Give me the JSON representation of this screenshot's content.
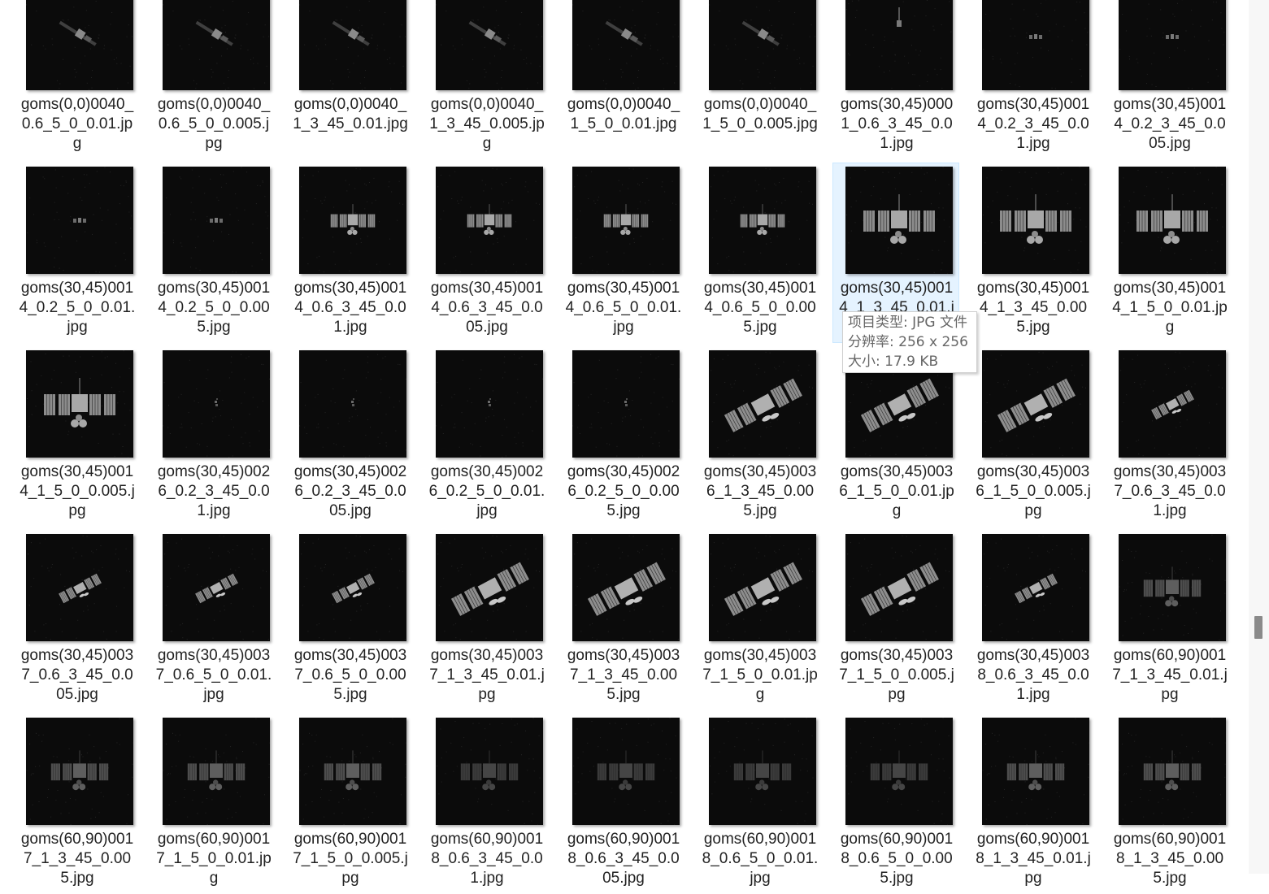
{
  "files": [
    {
      "name": "goms(0,0)0040_0.6_5_0_0.01.jpg",
      "icon": "image-thumbnail",
      "scene": "satellite-diagonal-small"
    },
    {
      "name": "goms(0,0)0040_0.6_5_0_0.005.jpg",
      "icon": "image-thumbnail",
      "scene": "satellite-diagonal-small"
    },
    {
      "name": "goms(0,0)0040_1_3_45_0.01.jpg",
      "icon": "image-thumbnail",
      "scene": "satellite-diagonal-small"
    },
    {
      "name": "goms(0,0)0040_1_3_45_0.005.jpg",
      "icon": "image-thumbnail",
      "scene": "satellite-diagonal-small"
    },
    {
      "name": "goms(0,0)0040_1_5_0_0.01.jpg",
      "icon": "image-thumbnail",
      "scene": "satellite-diagonal-small"
    },
    {
      "name": "goms(0,0)0040_1_5_0_0.005.jpg",
      "icon": "image-thumbnail",
      "scene": "satellite-diagonal-small"
    },
    {
      "name": "goms(30,45)0001_0.6_3_45_0.01.jpg",
      "icon": "image-thumbnail",
      "scene": "satellite-vertical-tiny"
    },
    {
      "name": "goms(30,45)0014_0.2_3_45_0.01.jpg",
      "icon": "image-thumbnail",
      "scene": "satellite-front-tiny"
    },
    {
      "name": "goms(30,45)0014_0.2_3_45_0.005.jpg",
      "icon": "image-thumbnail",
      "scene": "satellite-front-tiny"
    },
    {
      "name": "goms(30,45)0014_0.2_5_0_0.01.jpg",
      "icon": "image-thumbnail",
      "scene": "satellite-front-tiny"
    },
    {
      "name": "goms(30,45)0014_0.2_5_0_0.005.jpg",
      "icon": "image-thumbnail",
      "scene": "satellite-front-tiny"
    },
    {
      "name": "goms(30,45)0014_0.6_3_45_0.01.jpg",
      "icon": "image-thumbnail",
      "scene": "satellite-front-medium"
    },
    {
      "name": "goms(30,45)0014_0.6_3_45_0.005.jpg",
      "icon": "image-thumbnail",
      "scene": "satellite-front-medium"
    },
    {
      "name": "goms(30,45)0014_0.6_5_0_0.01.jpg",
      "icon": "image-thumbnail",
      "scene": "satellite-front-medium"
    },
    {
      "name": "goms(30,45)0014_0.6_5_0_0.005.jpg",
      "icon": "image-thumbnail",
      "scene": "satellite-front-medium"
    },
    {
      "name": "goms(30,45)0014_1_3_45_0.01.jpg",
      "icon": "image-thumbnail",
      "scene": "satellite-front-large",
      "selected": true
    },
    {
      "name": "goms(30,45)0014_1_3_45_0.005.jpg",
      "icon": "image-thumbnail",
      "scene": "satellite-front-large"
    },
    {
      "name": "goms(30,45)0014_1_5_0_0.01.jpg",
      "icon": "image-thumbnail",
      "scene": "satellite-front-large"
    },
    {
      "name": "goms(30,45)0014_1_5_0_0.005.jpg",
      "icon": "image-thumbnail",
      "scene": "satellite-front-large"
    },
    {
      "name": "goms(30,45)0026_0.2_3_45_0.01.jpg",
      "icon": "image-thumbnail",
      "scene": "satellite-speck"
    },
    {
      "name": "goms(30,45)0026_0.2_3_45_0.005.jpg",
      "icon": "image-thumbnail",
      "scene": "satellite-speck"
    },
    {
      "name": "goms(30,45)0026_0.2_5_0_0.01.jpg",
      "icon": "image-thumbnail",
      "scene": "satellite-speck"
    },
    {
      "name": "goms(30,45)0026_0.2_5_0_0.005.jpg",
      "icon": "image-thumbnail",
      "scene": "satellite-speck"
    },
    {
      "name": "goms(30,45)0036_1_3_45_0.005.jpg",
      "icon": "image-thumbnail",
      "scene": "satellite-angled-large"
    },
    {
      "name": "goms(30,45)0036_1_5_0_0.01.jpg",
      "icon": "image-thumbnail",
      "scene": "satellite-angled-large"
    },
    {
      "name": "goms(30,45)0036_1_5_0_0.005.jpg",
      "icon": "image-thumbnail",
      "scene": "satellite-angled-large"
    },
    {
      "name": "goms(30,45)0037_0.6_3_45_0.01.jpg",
      "icon": "image-thumbnail",
      "scene": "satellite-angled-small"
    },
    {
      "name": "goms(30,45)0037_0.6_3_45_0.005.jpg",
      "icon": "image-thumbnail",
      "scene": "satellite-angled-small"
    },
    {
      "name": "goms(30,45)0037_0.6_5_0_0.01.jpg",
      "icon": "image-thumbnail",
      "scene": "satellite-angled-small"
    },
    {
      "name": "goms(30,45)0037_0.6_5_0_0.005.jpg",
      "icon": "image-thumbnail",
      "scene": "satellite-angled-small"
    },
    {
      "name": "goms(30,45)0037_1_3_45_0.01.jpg",
      "icon": "image-thumbnail",
      "scene": "satellite-angled-large"
    },
    {
      "name": "goms(30,45)0037_1_3_45_0.005.jpg",
      "icon": "image-thumbnail",
      "scene": "satellite-angled-large"
    },
    {
      "name": "goms(30,45)0037_1_5_0_0.01.jpg",
      "icon": "image-thumbnail",
      "scene": "satellite-angled-large"
    },
    {
      "name": "goms(30,45)0037_1_5_0_0.005.jpg",
      "icon": "image-thumbnail",
      "scene": "satellite-angled-large"
    },
    {
      "name": "goms(30,45)0038_0.6_3_45_0.01.jpg",
      "icon": "image-thumbnail",
      "scene": "satellite-angled-small"
    },
    {
      "name": "goms(60,90)0017_1_3_45_0.01.jpg",
      "icon": "image-thumbnail",
      "scene": "satellite-front-dim"
    },
    {
      "name": "goms(60,90)0017_1_3_45_0.005.jpg",
      "icon": "image-thumbnail",
      "scene": "satellite-front-dim"
    },
    {
      "name": "goms(60,90)0017_1_5_0_0.01.jpg",
      "icon": "image-thumbnail",
      "scene": "satellite-front-dim"
    },
    {
      "name": "goms(60,90)0017_1_5_0_0.005.jpg",
      "icon": "image-thumbnail",
      "scene": "satellite-front-dim"
    },
    {
      "name": "goms(60,90)0018_0.6_3_45_0.01.jpg",
      "icon": "image-thumbnail",
      "scene": "satellite-front-faint"
    },
    {
      "name": "goms(60,90)0018_0.6_3_45_0.005.jpg",
      "icon": "image-thumbnail",
      "scene": "satellite-front-faint"
    },
    {
      "name": "goms(60,90)0018_0.6_5_0_0.01.jpg",
      "icon": "image-thumbnail",
      "scene": "satellite-front-faint"
    },
    {
      "name": "goms(60,90)0018_0.6_5_0_0.005.jpg",
      "icon": "image-thumbnail",
      "scene": "satellite-front-faint"
    },
    {
      "name": "goms(60,90)0018_1_3_45_0.01.jpg",
      "icon": "image-thumbnail",
      "scene": "satellite-front-dim"
    },
    {
      "name": "goms(60,90)0018_1_3_45_0.005.jpg",
      "icon": "image-thumbnail",
      "scene": "satellite-front-dim"
    }
  ],
  "tooltip": {
    "type_line": "项目类型: JPG 文件",
    "resolution_line": "分辨率: 256 x 256",
    "size_line": "大小: 17.9 KB"
  },
  "colors": {
    "thumbnail_bg": "#0b0b0b",
    "selection_bg": "#e5f3ff",
    "selection_border": "#cce8ff",
    "text": "#222222"
  }
}
